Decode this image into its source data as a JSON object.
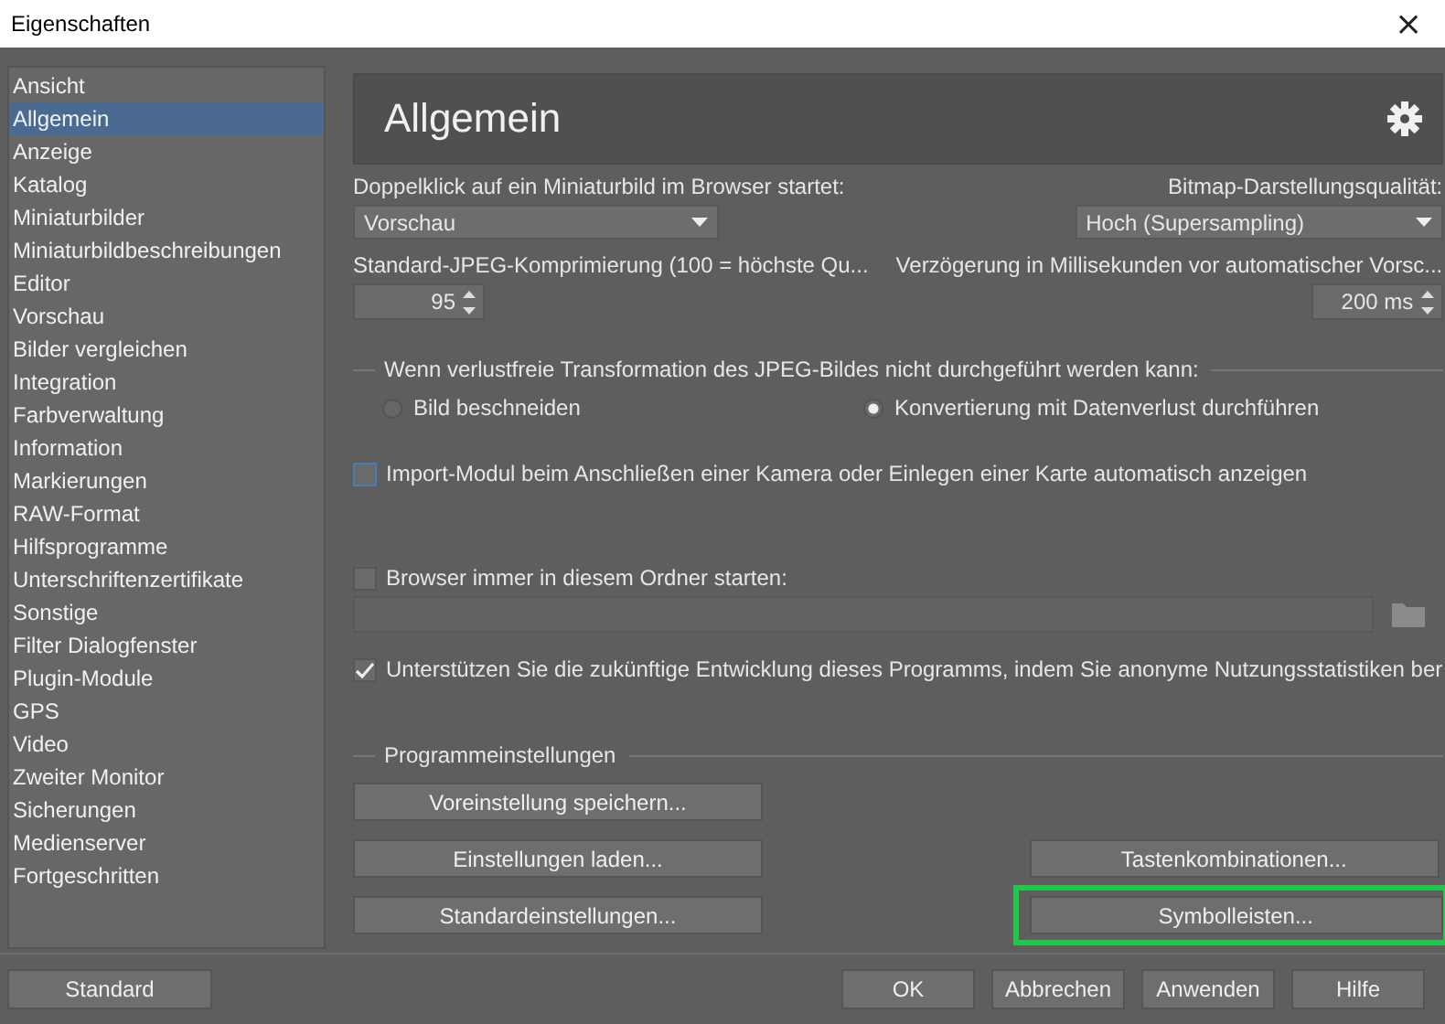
{
  "window": {
    "title": "Eigenschaften",
    "close": "×"
  },
  "sidebar": {
    "items": [
      {
        "label": "Ansicht",
        "selected": false
      },
      {
        "label": "Allgemein",
        "selected": true
      },
      {
        "label": "Anzeige",
        "selected": false
      },
      {
        "label": "Katalog",
        "selected": false
      },
      {
        "label": "Miniaturbilder",
        "selected": false
      },
      {
        "label": "Miniaturbildbeschreibungen",
        "selected": false
      },
      {
        "label": "Editor",
        "selected": false
      },
      {
        "label": "Vorschau",
        "selected": false
      },
      {
        "label": "Bilder vergleichen",
        "selected": false
      },
      {
        "label": "Integration",
        "selected": false
      },
      {
        "label": "Farbverwaltung",
        "selected": false
      },
      {
        "label": "Information",
        "selected": false
      },
      {
        "label": "Markierungen",
        "selected": false
      },
      {
        "label": "RAW-Format",
        "selected": false
      },
      {
        "label": "Hilfsprogramme",
        "selected": false
      },
      {
        "label": "Unterschriftenzertifikate",
        "selected": false
      },
      {
        "label": "Sonstige",
        "selected": false
      },
      {
        "label": "Filter Dialogfenster",
        "selected": false
      },
      {
        "label": "Plugin-Module",
        "selected": false
      },
      {
        "label": "GPS",
        "selected": false
      },
      {
        "label": "Video",
        "selected": false
      },
      {
        "label": "Zweiter Monitor",
        "selected": false
      },
      {
        "label": "Sicherungen",
        "selected": false
      },
      {
        "label": "Medienserver",
        "selected": false
      },
      {
        "label": "Fortgeschritten",
        "selected": false
      }
    ]
  },
  "page": {
    "title": "Allgemein",
    "double_click": {
      "label": "Doppelklick auf ein Miniaturbild im Browser startet:",
      "value": "Vorschau"
    },
    "bitmap_quality": {
      "label": "Bitmap-Darstellungsqualität:",
      "value": "Hoch (Supersampling)"
    },
    "jpeg_compression": {
      "label": "Standard-JPEG-Komprimierung (100 = höchste Qu...",
      "value": "95"
    },
    "delay": {
      "label": "Verzögerung in Millisekunden vor automatischer Vorsc...",
      "value": "200 ms"
    },
    "lossless_group": {
      "title": "Wenn verlustfreie Transformation des JPEG-Bildes nicht durchgeführt werden kann:",
      "options": [
        {
          "label": "Bild beschneiden",
          "selected": false
        },
        {
          "label": "Konvertierung mit Datenverlust durchführen",
          "selected": true
        }
      ]
    },
    "import_module": {
      "label": "Import-Modul beim Anschließen einer Kamera oder Einlegen einer Karte automatisch anzeigen",
      "checked": false,
      "focused": true
    },
    "start_folder": {
      "label": "Browser immer in diesem Ordner starten:",
      "checked": false
    },
    "statistics": {
      "label": "Unterstützen Sie die zukünftige Entwicklung dieses Programms, indem Sie anonyme Nutzungsstatistiken ber",
      "checked": true
    },
    "program_settings": {
      "title": "Programmeinstellungen",
      "left_buttons": [
        {
          "label": "Voreinstellung speichern...",
          "highlighted": false
        },
        {
          "label": "Einstellungen laden...",
          "highlighted": false
        },
        {
          "label": "Standardeinstellungen...",
          "highlighted": false
        }
      ],
      "right_buttons": [
        {
          "label": "Tastenkombinationen...",
          "highlighted": false
        },
        {
          "label": "Symbolleisten...",
          "highlighted": true
        }
      ]
    }
  },
  "footer": {
    "standard": "Standard",
    "buttons": [
      "OK",
      "Abbrechen",
      "Anwenden",
      "Hilfe"
    ]
  }
}
